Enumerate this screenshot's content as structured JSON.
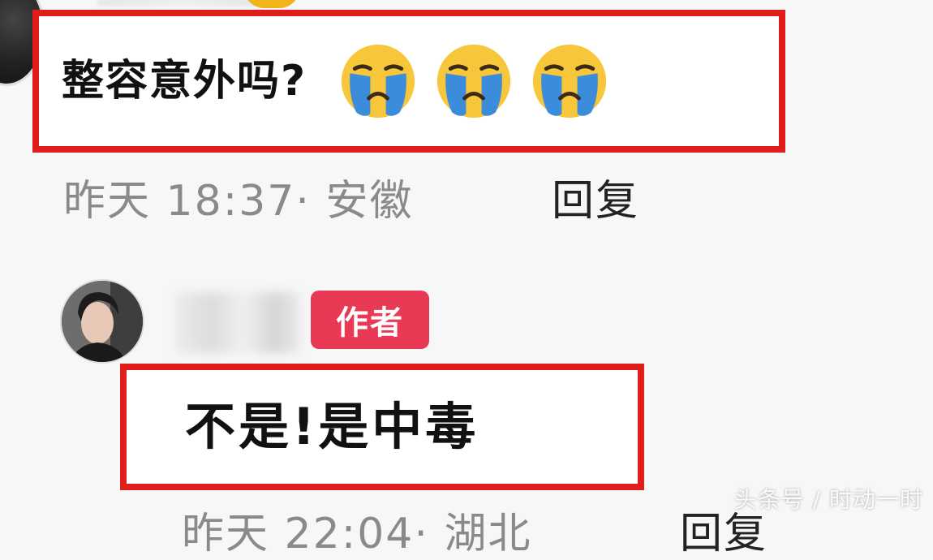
{
  "comments": [
    {
      "text": "整容意外吗?",
      "emoji_icon": "loudly-crying-face-icon",
      "emoji_count": 3,
      "meta": "昨天 18:37· 安徽",
      "reply_label": "回复"
    },
    {
      "author_badge": "作者",
      "text": "不是!是中毒",
      "meta": "昨天 22:04· 湖北",
      "reply_label": "回复"
    }
  ],
  "watermark": "头条号 / 时动一时",
  "colors": {
    "highlight_border": "#e01d1d",
    "author_badge": "#e83a55",
    "meta_text": "#8a8a8a",
    "emoji_face": "#f8c63a",
    "emoji_tears": "#3b8ddb"
  }
}
